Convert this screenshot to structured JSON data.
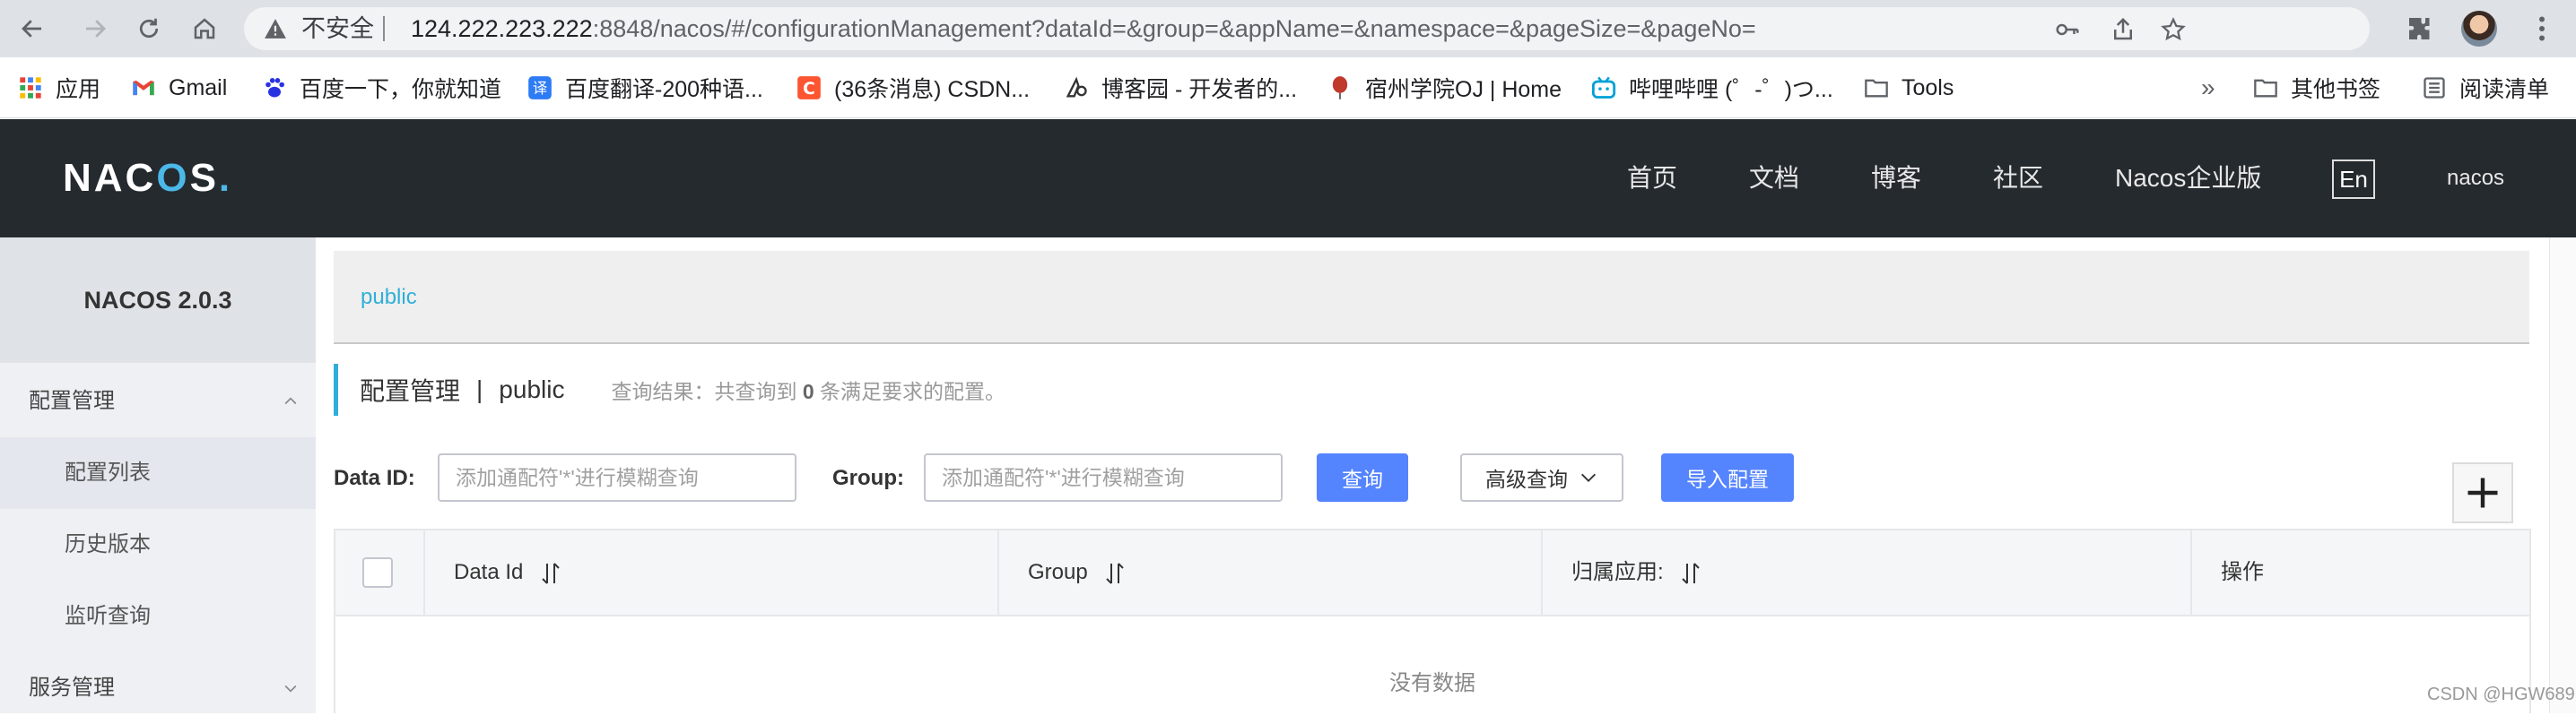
{
  "browser": {
    "security_text": "不安全",
    "url_host": "124.222.223.222",
    "url_rest": ":8848/nacos/#/configurationManagement?dataId=&group=&appName=&namespace=&pageSize=&pageNo=",
    "bookmarks": [
      {
        "label": "应用",
        "icon": "apps-grid-icon"
      },
      {
        "label": "Gmail",
        "icon": "gmail-icon"
      },
      {
        "label": "百度一下，你就知道",
        "icon": "baidu-paw-icon"
      },
      {
        "label": "百度翻译-200种语...",
        "icon": "baidu-translate-icon"
      },
      {
        "label": "(36条消息) CSDN...",
        "icon": "csdn-icon"
      },
      {
        "label": "博客园 - 开发者的...",
        "icon": "cnblogs-icon"
      },
      {
        "label": "宿州学院OJ | Home",
        "icon": "balloon-icon"
      },
      {
        "label": "哔哩哔哩 (゜-゜)つ...",
        "icon": "bilibili-icon"
      },
      {
        "label": "Tools",
        "icon": "folder-icon"
      }
    ],
    "overflow": "»",
    "other_bookmarks": "其他书签",
    "reading_list": "阅读清单",
    "colors": {
      "chrome": "#dee1e6",
      "omnibox": "#f1f3f4"
    }
  },
  "header": {
    "logo": {
      "part1": "NAC",
      "part2": "O",
      "part3": "S",
      "part4": "."
    },
    "nav": [
      "首页",
      "文档",
      "博客",
      "社区",
      "Nacos企业版"
    ],
    "lang": "En",
    "user": "nacos",
    "colors": {
      "bg": "#252a2f",
      "accent": "#4bb8e8"
    }
  },
  "sidebar": {
    "version": "NACOS 2.0.3",
    "groups": [
      {
        "label": "配置管理",
        "expanded": true,
        "items": [
          "配置列表",
          "历史版本",
          "监听查询"
        ]
      },
      {
        "label": "服务管理",
        "expanded": false,
        "items": []
      }
    ]
  },
  "main": {
    "namespace": "public",
    "title": "配置管理",
    "title_sep": "|",
    "title_ns": "public",
    "result_prefix": "查询结果：共查询到",
    "result_count": "0",
    "result_suffix": "条满足要求的配置。",
    "filters": {
      "data_id_label": "Data ID:",
      "data_id_placeholder": "添加通配符'*'进行模糊查询",
      "group_label": "Group:",
      "group_placeholder": "添加通配符'*'进行模糊查询",
      "query_button": "查询",
      "advanced_button": "高级查询",
      "import_button": "导入配置"
    },
    "table": {
      "columns": [
        "Data Id",
        "Group",
        "归属应用:",
        "操作"
      ],
      "empty_text": "没有数据"
    },
    "colors": {
      "primary": "#5584ff",
      "link": "#2eafd7"
    }
  },
  "watermark": "CSDN @HGW689"
}
